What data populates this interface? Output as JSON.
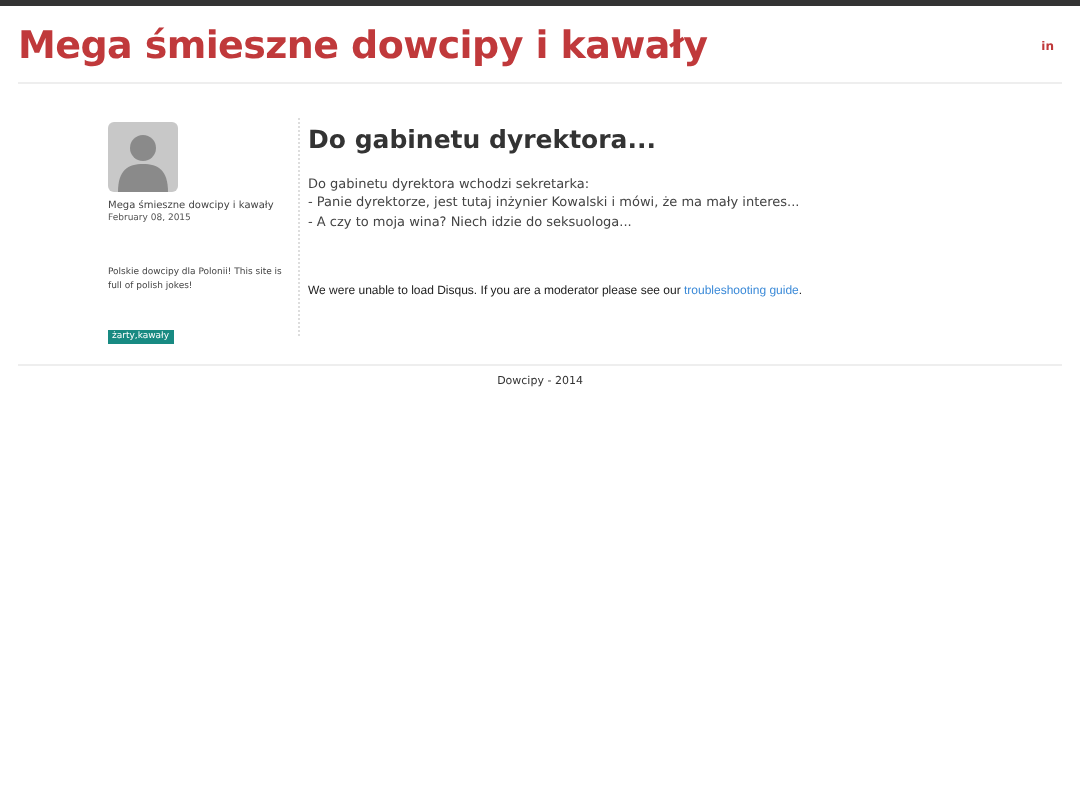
{
  "header": {
    "title": "Mega śmieszne dowcipy i kawały",
    "social": "in"
  },
  "sidebar": {
    "author": "Mega śmieszne dowcipy i kawały",
    "date": "February 08, 2015",
    "description": "Polskie dowcipy dla Polonii! This site is full of polish jokes!",
    "tags": [
      "żarty,kawały"
    ]
  },
  "post": {
    "title": "Do gabinetu dyrektora...",
    "lines": [
      "Do gabinetu dyrektora wchodzi sekretarka:",
      "- Panie dyrektorze, jest tutaj inżynier Kowalski i mówi, że ma mały interes...",
      "- A czy to moja wina? Niech idzie do seksuologa..."
    ]
  },
  "comments": {
    "message": "We were unable to load Disqus. If you are a moderator please see our ",
    "link": "troubleshooting guide",
    "after": "."
  },
  "footer": {
    "text": "Dowcipy - 2014"
  }
}
